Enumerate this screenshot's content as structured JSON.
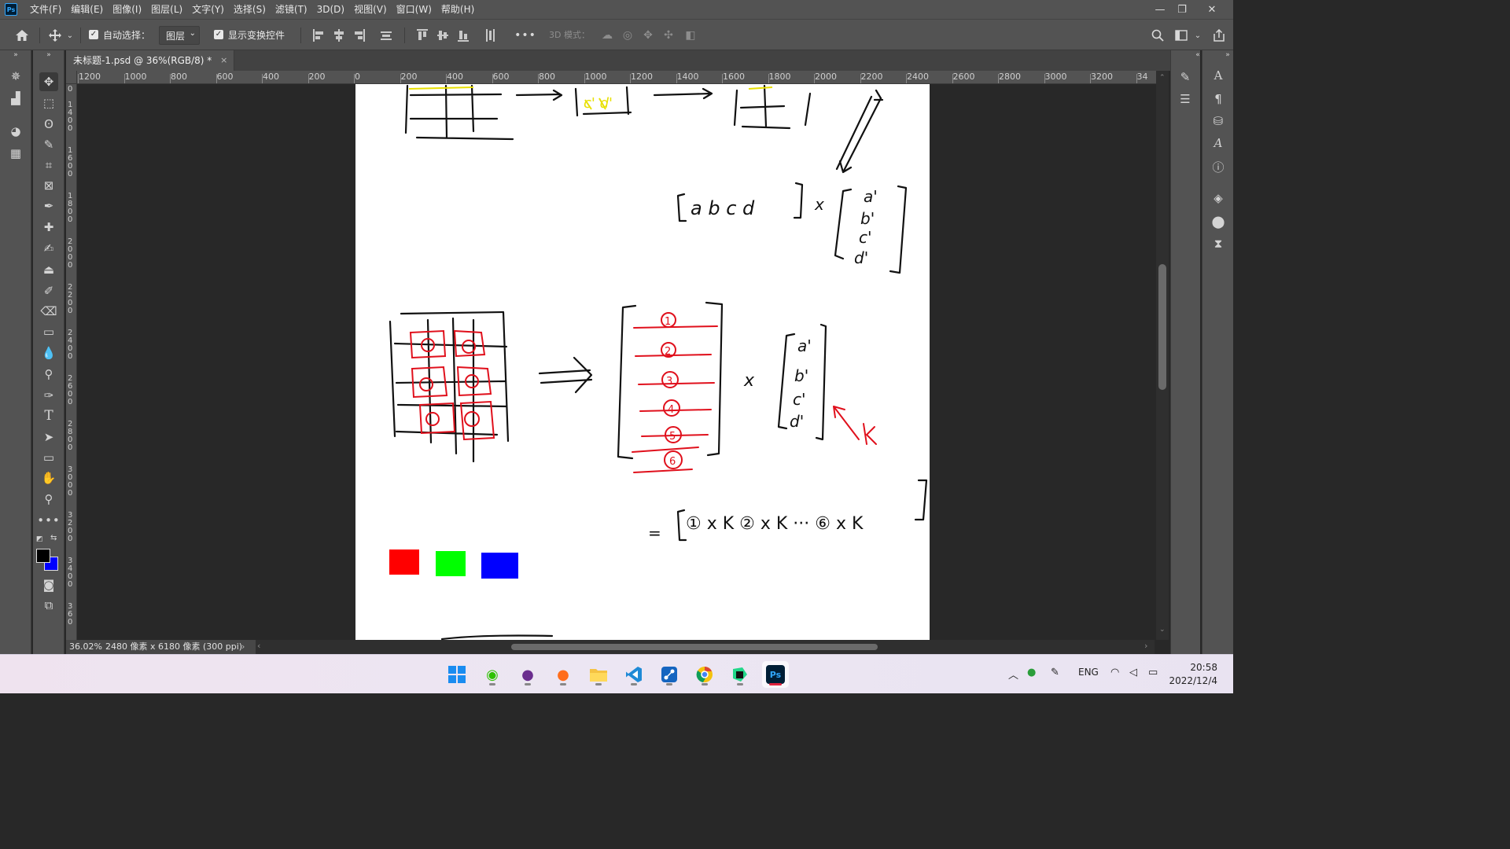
{
  "menubar": {
    "app_logo": "Ps",
    "items": [
      "文件(F)",
      "编辑(E)",
      "图像(I)",
      "图层(L)",
      "文字(Y)",
      "选择(S)",
      "滤镜(T)",
      "3D(D)",
      "视图(V)",
      "窗口(W)",
      "帮助(H)"
    ],
    "window_controls": [
      "minimize-icon",
      "restore-icon",
      "close-icon"
    ]
  },
  "options": {
    "auto_select_label": "自动选择：",
    "auto_select_checked": true,
    "auto_select_value": "图层",
    "show_transform_label": "显示变换控件",
    "show_transform_checked": true,
    "more": "•••",
    "mode_3d_label": "3D 模式："
  },
  "document": {
    "tab_title": "未标题-1.psd @ 36%(RGB/8) *",
    "tab_close": "×",
    "zoom": "36.02%",
    "doc_info": "2480 像素 x 6180 像素 (300 ppi)",
    "status_arrow": "›",
    "hscroll_left": "‹",
    "hscroll_right": "›"
  },
  "ruler_h": [
    "1200",
    "1000",
    "800",
    "600",
    "400",
    "200",
    "0",
    "200",
    "400",
    "600",
    "800",
    "1000",
    "1200",
    "1400",
    "1600",
    "1800",
    "2000",
    "2200",
    "2400",
    "2600",
    "2800",
    "3000",
    "3200",
    "34"
  ],
  "ruler_v": [
    "0",
    "1400",
    "1600",
    "1800",
    "2000",
    "2200",
    "2400",
    "2600",
    "2800",
    "3000",
    "3200",
    "3400",
    "360"
  ],
  "canvas_swatches": [
    {
      "name": "red-swatch",
      "color": "#ff0000"
    },
    {
      "name": "green-swatch",
      "color": "#00ff00"
    },
    {
      "name": "blue-swatch",
      "color": "#0000ff"
    }
  ],
  "handwriting": {
    "top_labels": "c' d'",
    "row_vector": "[a b c d]",
    "times": "x",
    "col_vector": [
      "a'",
      "b'",
      "c'",
      "d'"
    ],
    "circled": [
      "①",
      "②",
      "③",
      "④",
      "⑤",
      "⑥"
    ],
    "arrow": "⟹",
    "col_vector2": [
      "a'",
      "b'",
      "c'",
      "d'"
    ],
    "k_label": "K",
    "result": "= [①×K  ②×K ··· ⑥×K]"
  },
  "taskbar": {
    "apps": [
      {
        "name": "start-button",
        "icon": "windows-icon"
      },
      {
        "name": "wechat-app",
        "icon": "wechat-icon"
      },
      {
        "name": "github-app",
        "icon": "github-icon"
      },
      {
        "name": "firefox-app",
        "icon": "firefox-icon"
      },
      {
        "name": "explorer-app",
        "icon": "folder-icon"
      },
      {
        "name": "vscode-app",
        "icon": "vscode-icon"
      },
      {
        "name": "network-app",
        "icon": "network-icon"
      },
      {
        "name": "chrome-app",
        "icon": "chrome-icon"
      },
      {
        "name": "pycharm-app",
        "icon": "pycharm-icon"
      },
      {
        "name": "photoshop-app",
        "icon": "ps-icon"
      }
    ],
    "ps_label": "Ps",
    "lang": "ENG",
    "time": "20:58",
    "date": "2022/12/4"
  },
  "colors": {
    "foreground": "#000000",
    "background": "#0000ff",
    "accent": "#31a8ff",
    "ink_red": "#e0101c",
    "ink_yellow": "#e8e000"
  }
}
